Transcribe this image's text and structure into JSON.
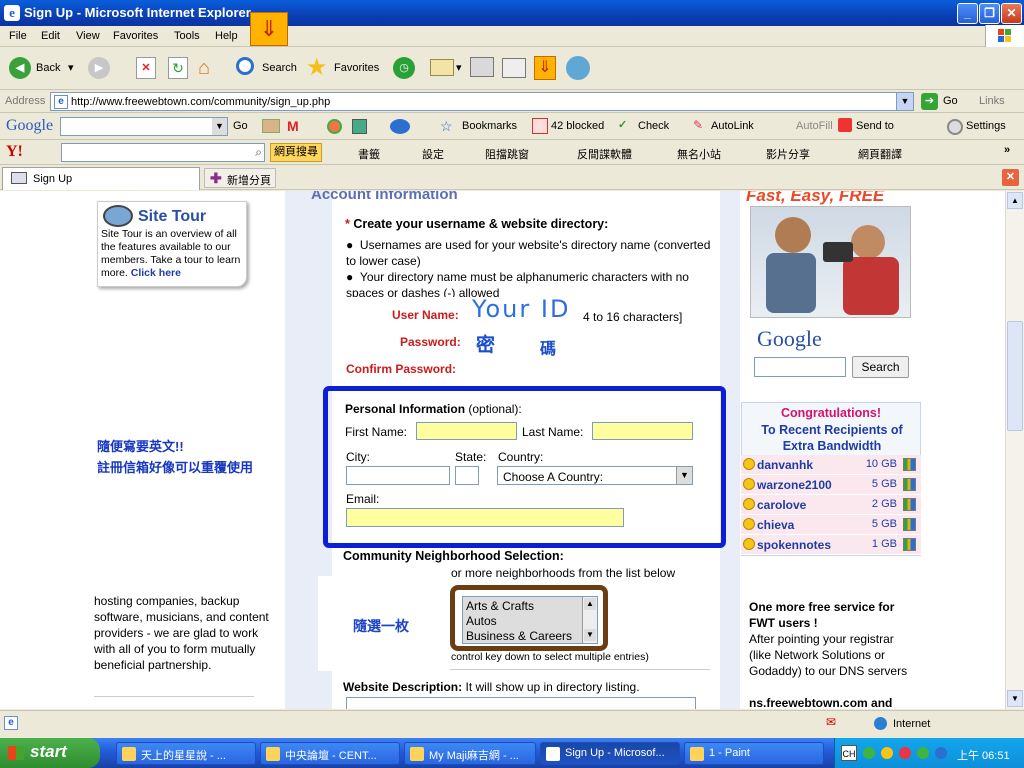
{
  "window": {
    "title": "Sign Up - Microsoft Internet Explorer",
    "ie_letter": "e"
  },
  "menu": [
    "File",
    "Edit",
    "View",
    "Favorites",
    "Tools",
    "Help"
  ],
  "toolbar": {
    "back": "Back",
    "search": "Search",
    "favorites": "Favorites"
  },
  "address": {
    "label": "Address",
    "url": "http://www.freewebtown.com/community/sign_up.php",
    "go": "Go",
    "links": "Links"
  },
  "googlebar": {
    "logo": "Google",
    "go": "Go",
    "bookmarks": "Bookmarks",
    "blocked": "42 blocked",
    "check": "Check",
    "autolink": "AutoLink",
    "autofill": "AutoFill",
    "sendto": "Send to",
    "settings": "Settings"
  },
  "yahoobar": {
    "logo": "Y!",
    "search_btn": "網頁搜尋",
    "items": [
      "書籤",
      "設定",
      "阻擋跳窗",
      "反間諜軟體",
      "無名小站",
      "影片分享",
      "網頁翻譯"
    ]
  },
  "tabs": [
    {
      "label": "Sign Up"
    },
    {
      "label": "新增分頁"
    }
  ],
  "colors": {
    "accent": "#1838c0",
    "red_label": "#cc1b1b",
    "yellow_field": "#ffffa0",
    "annot_blue": "#0b1fd6",
    "annot_brown": "#6b3d12"
  },
  "left": {
    "site_tour_title": "Site Tour",
    "site_tour_text": "Site Tour is an overview of all the features available to our members. Take a tour to learn more.",
    "click_here": "Click here",
    "note1": "隨便寫要英文!!",
    "note2": "註冊信箱好像可以重覆使用",
    "partners_text": "hosting companies, backup software, musicians, and content providers - we are glad to work with all of you to form mutually beneficial partnership."
  },
  "form": {
    "section_title": "Account Information",
    "create_title": "Create your username & website directory:",
    "bullet1": "Usernames are used for your website's directory name (converted to lower case)",
    "bullet2": "Your directory name must be alphanumeric characters with no spaces or dashes (-) allowed",
    "username_label": "User Name:",
    "username_hint": "4 to 16 characters]",
    "your_id": "Your ID",
    "password_label": "Password:",
    "pw_char1": "密",
    "pw_char2": "碼",
    "confirm_label": "Confirm Password:",
    "personal_title": "Personal Information",
    "optional": "(optional):",
    "first_name": "First Name:",
    "last_name": "Last Name:",
    "city": "City:",
    "state": "State:",
    "country": "Country:",
    "country_select": "Choose A Country:",
    "email": "Email:",
    "community_title": "Community Neighborhood Selection:",
    "community_text1": "or more neighborhoods from the list below",
    "community_text2": "control key down to select multiple entries)",
    "random_note": "隨選一枚",
    "neighborhoods": [
      "Arts & Crafts",
      "Autos",
      "Business & Careers"
    ],
    "website_desc_label": "Website Description:",
    "website_desc_text": "It will show up in directory listing."
  },
  "right": {
    "fast_easy": "Fast, Easy, FREE",
    "google_logo": "Google",
    "search_btn": "Search",
    "congrats": "Congratulations!",
    "recipients": "To Recent Recipients of Extra Bandwidth",
    "users": [
      {
        "name": "danvanhk",
        "size": "10 GB"
      },
      {
        "name": "warzone2100",
        "size": "5 GB"
      },
      {
        "name": "carolove",
        "size": "2 GB"
      },
      {
        "name": "chieva",
        "size": "5 GB"
      },
      {
        "name": "spokennotes",
        "size": "1 GB"
      }
    ],
    "more_title": "One more free service for FWT users !",
    "more_text": "After pointing your registrar (like Network Solutions or Godaddy) to our DNS servers",
    "ns": "ns.freewebtown.com and"
  },
  "status": {
    "zone": "Internet"
  },
  "taskbar": {
    "start": "start",
    "tasks": [
      "天上的星星說 - ...",
      "中央論壇 - CENT...",
      "My Maji麻吉網 - ...",
      "Sign Up - Microsof...",
      "1 - Paint"
    ],
    "clock": "上午 06:51",
    "lang": "CH"
  }
}
